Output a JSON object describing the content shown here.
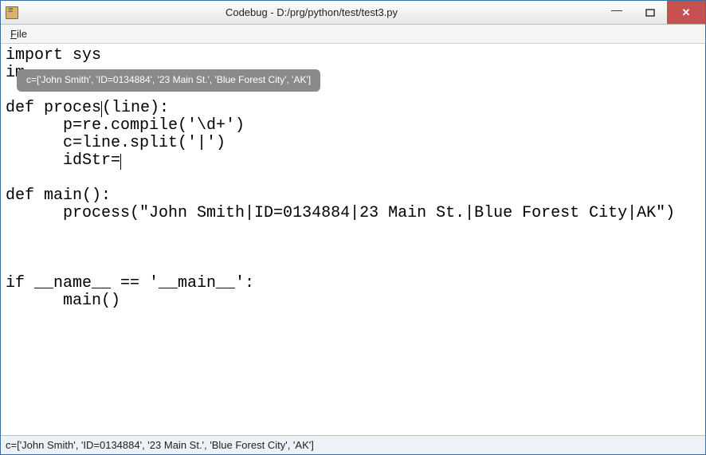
{
  "window": {
    "title": "Codebug - D:/prg/python/test/test3.py"
  },
  "menu": {
    "file_label": "File",
    "file_underline": "F",
    "file_rest": "ile"
  },
  "code": {
    "line1": "import sys",
    "line2_vis": "im",
    "line3": "",
    "line4_a": "def proces",
    "line4_b": "(line):",
    "line5": "      p=re.compile('\\d+')",
    "line6": "      c=line.split('|')",
    "line7": "      idStr=",
    "line8": "",
    "line9": "def main():",
    "line10_a": "      ",
    "line10_b": "process(\"John Smith|ID=0134884|23 Main St.|Blue Forest City|AK\")",
    "line11": "",
    "line12": "",
    "line13": "",
    "line14": "if __name__ == '__main__':",
    "line15": "      main()"
  },
  "tooltip": {
    "text": "c=['John Smith', 'ID=0134884', '23 Main St.', 'Blue Forest City', 'AK']"
  },
  "status": {
    "text": "c=['John Smith', 'ID=0134884', '23 Main St.', 'Blue Forest City', 'AK']"
  }
}
